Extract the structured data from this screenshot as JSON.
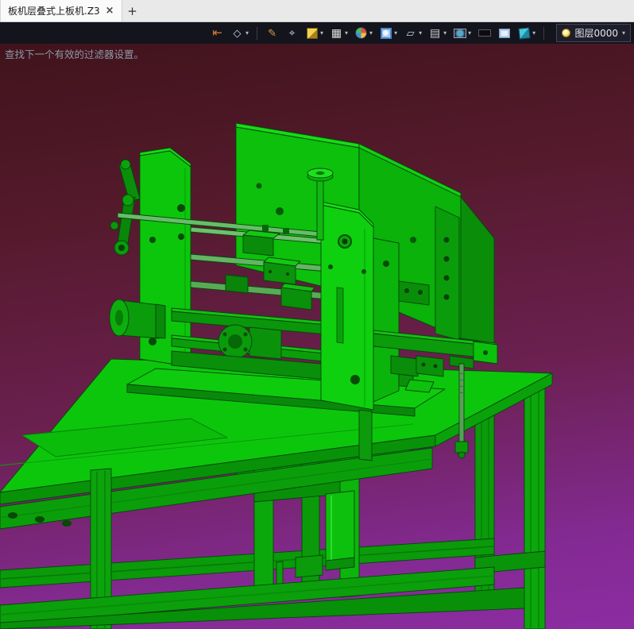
{
  "tabbar": {
    "tab_title": "板机层叠式上板机.Z3",
    "close_glyph": "×",
    "new_tab_glyph": "+"
  },
  "toolbar": {
    "dropdown_glyph": "▾",
    "layer_label": "图层0000",
    "icons": [
      {
        "name": "exit-icon",
        "glyph": "⇤"
      },
      {
        "name": "note-icon",
        "glyph": "◇"
      },
      {
        "name": "pencil-icon",
        "glyph": "✎"
      },
      {
        "name": "probe-icon",
        "glyph": "⌖"
      },
      {
        "name": "shaded-cube-icon",
        "glyph": ""
      },
      {
        "name": "wireframe-cube-icon",
        "glyph": "▦"
      },
      {
        "name": "color-pie-icon",
        "glyph": ""
      },
      {
        "name": "zoom-window-icon",
        "glyph": ""
      },
      {
        "name": "clip-plane-icon",
        "glyph": "▱"
      },
      {
        "name": "hatch-icon",
        "glyph": "▤"
      },
      {
        "name": "screen-icon",
        "glyph": ""
      },
      {
        "name": "background-icon",
        "glyph": ""
      },
      {
        "name": "panel-icon",
        "glyph": ""
      },
      {
        "name": "view-cube-icon",
        "glyph": ""
      },
      {
        "name": "bulb-icon",
        "glyph": ""
      }
    ]
  },
  "viewport": {
    "status_message": "查找下一个有效的过滤器设置。"
  },
  "colors": {
    "model_green": "#0cc60c",
    "background_top": "#40131c",
    "background_bottom": "#8c2ca2",
    "toolbar_bg": "#14141d"
  }
}
